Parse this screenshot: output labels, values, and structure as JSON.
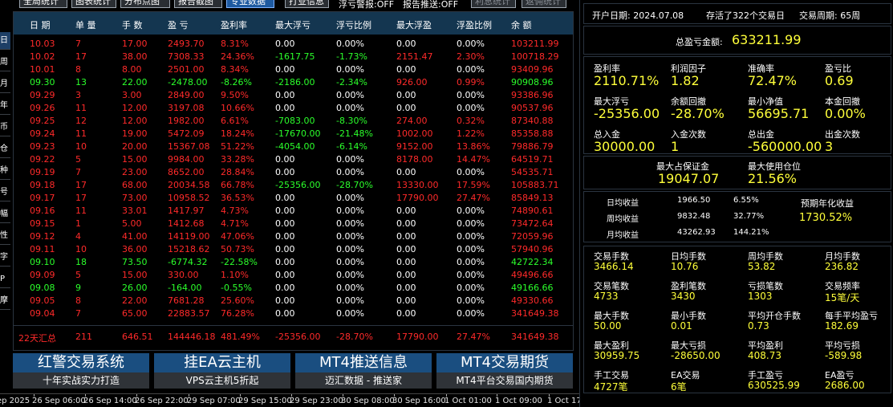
{
  "toolbar": {
    "buttons": [
      {
        "label": "全局统计"
      },
      {
        "label": "图表统计"
      },
      {
        "label": "分布点图"
      },
      {
        "label": "报告截图"
      },
      {
        "label": "专业数据"
      },
      {
        "label": "打业信息"
      },
      {
        "label": "利息统计"
      },
      {
        "label": "返佣统计"
      }
    ],
    "float_warn": "浮亏警报:OFF",
    "report_push": "报告推送:OFF"
  },
  "vtabs": [
    "日",
    "周",
    "月",
    "年",
    "币",
    "仓",
    "种",
    "号",
    "幅",
    "性",
    "字",
    "P",
    "摩"
  ],
  "table": {
    "headers": [
      "日 期",
      "单 量",
      "手 数",
      "盈 亏",
      "盈利率",
      "最大浮亏",
      "浮亏比例",
      "最大浮盈",
      "浮盈比例",
      "余 额"
    ],
    "rows": [
      [
        "10.03",
        "7",
        "17.00",
        "2493.70",
        "8.31%",
        "0.00",
        "0.00%",
        "0.00",
        "0.00%",
        "103211.99"
      ],
      [
        "10.02",
        "17",
        "38.00",
        "7308.33",
        "24.36%",
        "-1617.75",
        "-1.73%",
        "2151.47",
        "2.30%",
        "100718.29"
      ],
      [
        "10.01",
        "8",
        "8.00",
        "2501.00",
        "8.34%",
        "0.00",
        "0.00%",
        "0.00",
        "0.00%",
        "93409.96"
      ],
      [
        "09.30",
        "13",
        "22.00",
        "-2478.00",
        "-8.26%",
        "-2186.00",
        "-2.34%",
        "926.00",
        "0.99%",
        "90908.96"
      ],
      [
        "09.29",
        "3",
        "3.00",
        "2849.00",
        "9.50%",
        "0.00",
        "0.00%",
        "0.00",
        "0.00%",
        "93386.96"
      ],
      [
        "09.26",
        "11",
        "12.00",
        "3197.08",
        "10.66%",
        "0.00",
        "0.00%",
        "0.00",
        "0.00%",
        "90537.96"
      ],
      [
        "09.25",
        "12",
        "12.00",
        "1982.00",
        "6.61%",
        "-7083.00",
        "-8.30%",
        "274.00",
        "0.32%",
        "87340.88"
      ],
      [
        "09.24",
        "11",
        "19.00",
        "5472.09",
        "18.24%",
        "-17670.00",
        "-21.48%",
        "1002.00",
        "1.22%",
        "85358.88"
      ],
      [
        "09.23",
        "10",
        "20.00",
        "15367.08",
        "51.22%",
        "-4054.00",
        "-6.14%",
        "9152.00",
        "13.86%",
        "79886.79"
      ],
      [
        "09.22",
        "5",
        "15.00",
        "9984.00",
        "33.28%",
        "0.00",
        "0.00%",
        "8178.00",
        "14.47%",
        "64519.71"
      ],
      [
        "09.19",
        "7",
        "23.00",
        "8652.00",
        "28.84%",
        "0.00",
        "0.00%",
        "0.00",
        "0.00%",
        "54535.71"
      ],
      [
        "09.18",
        "17",
        "68.00",
        "20034.58",
        "66.78%",
        "-25356.00",
        "-28.70%",
        "13330.00",
        "17.59%",
        "105883.71"
      ],
      [
        "09.17",
        "17",
        "73.00",
        "10958.52",
        "36.53%",
        "0.00",
        "0.00%",
        "17790.00",
        "27.47%",
        "85849.13"
      ],
      [
        "09.16",
        "11",
        "33.01",
        "1417.97",
        "4.73%",
        "0.00",
        "0.00%",
        "0.00",
        "0.00%",
        "74890.61"
      ],
      [
        "09.15",
        "1",
        "5.00",
        "1412.68",
        "4.71%",
        "0.00",
        "0.00%",
        "0.00",
        "0.00%",
        "73472.64"
      ],
      [
        "09.12",
        "4",
        "41.00",
        "14119.00",
        "47.06%",
        "0.00",
        "0.00%",
        "0.00",
        "0.00%",
        "72059.96"
      ],
      [
        "09.11",
        "10",
        "36.00",
        "15218.62",
        "50.73%",
        "0.00",
        "0.00%",
        "0.00",
        "0.00%",
        "57940.96"
      ],
      [
        "09.10",
        "18",
        "73.50",
        "-6774.32",
        "-22.58%",
        "0.00",
        "0.00%",
        "0.00",
        "0.00%",
        "42722.34"
      ],
      [
        "09.09",
        "5",
        "15.00",
        "330.00",
        "1.10%",
        "0.00",
        "0.00%",
        "0.00",
        "0.00%",
        "49496.66"
      ],
      [
        "09.08",
        "9",
        "26.00",
        "-164.00",
        "-0.55%",
        "0.00",
        "0.00%",
        "0.00",
        "0.00%",
        "49166.66"
      ],
      [
        "09.05",
        "8",
        "22.00",
        "7681.28",
        "25.60%",
        "0.00",
        "0.00%",
        "0.00",
        "0.00%",
        "49330.66"
      ],
      [
        "09.04",
        "7",
        "65.00",
        "22883.57",
        "76.28%",
        "0.00",
        "0.00%",
        "0.00",
        "0.00%",
        "341649.38"
      ]
    ],
    "summary": [
      "22天汇总",
      "211",
      "646.51",
      "144446.18",
      "481.49%",
      "-25356.00",
      "-28.70%",
      "17790.00",
      "27.47%",
      "341649.38"
    ]
  },
  "ads": [
    {
      "title": "红警交易系统",
      "sub": "十年实战实力打造"
    },
    {
      "title": "挂EA云主机",
      "sub": "VPS云主机5折起"
    },
    {
      "title": "MT4推送信息",
      "sub": "迈汇数据 - 推送家"
    },
    {
      "title": "MT4交易期货",
      "sub": "MT4平台交易国内期货"
    }
  ],
  "timeline": [
    "ep 2025",
    "26 Sep 06:00",
    "26 Sep 14:00",
    "26 Sep 22:00",
    "29 Sep 07:00",
    "29 Sep 15:00",
    "29 Sep 23:00",
    "30 Sep 08:00",
    "30 Sep 16:00",
    "1 Oct 01:00",
    "1 Oct 09:00",
    "1 Oct 17:00",
    "2 Oct 02:00",
    "2 Oct 10:00",
    "2 Oct 18:00",
    "3 Oct 03:00"
  ],
  "panel": {
    "header": {
      "open_date": "开户日期: 2024.07.08",
      "alive": "存活了322个交易日",
      "cycle": "交易周期: 65周"
    },
    "total": {
      "label": "总盈亏金额:",
      "value": "633211.99"
    },
    "grid1": [
      [
        {
          "label": "盈利率",
          "value": "2110.71%"
        },
        {
          "label": "利润因子",
          "value": "1.82"
        },
        {
          "label": "准确率",
          "value": "72.47%"
        },
        {
          "label": "盈亏比",
          "value": "0.69"
        }
      ],
      [
        {
          "label": "最大浮亏",
          "value": "-25356.00"
        },
        {
          "label": "余额回撤",
          "value": "-28.70%"
        },
        {
          "label": "最小净值",
          "value": "56695.71"
        },
        {
          "label": "本金回撤",
          "value": "0.00%"
        }
      ],
      [
        {
          "label": "总入金",
          "value": "30000.00"
        },
        {
          "label": "入金次数",
          "value": "1"
        },
        {
          "label": "总出金",
          "value": "-560000.00"
        },
        {
          "label": "出金次数",
          "value": "3"
        }
      ]
    ],
    "margin": [
      {
        "label": "最大占保证金",
        "value": "19047.07"
      },
      {
        "label": "最大使用仓位",
        "value": "21.56%"
      }
    ],
    "avg": [
      {
        "label": "日均收益",
        "amount": "1966.50",
        "pct": "6.55%"
      },
      {
        "label": "周均收益",
        "amount": "9832.48",
        "pct": "32.77%"
      },
      {
        "label": "月均收益",
        "amount": "43262.93",
        "pct": "144.21%"
      }
    ],
    "annual": {
      "label": "预期年化收益",
      "value": "1730.52%"
    },
    "grid2": [
      [
        {
          "label": "交易手数",
          "value": "3466.14"
        },
        {
          "label": "日均手数",
          "value": "10.76"
        },
        {
          "label": "周均手数",
          "value": "53.82"
        },
        {
          "label": "月均手数",
          "value": "236.82"
        }
      ],
      [
        {
          "label": "交易笔数",
          "value": "4733"
        },
        {
          "label": "盈利笔数",
          "value": "3430"
        },
        {
          "label": "亏损笔数",
          "value": "1303"
        },
        {
          "label": "交易频率",
          "value": "15笔/天"
        }
      ],
      [
        {
          "label": "最大手数",
          "value": "50.00"
        },
        {
          "label": "最小手数",
          "value": "0.01"
        },
        {
          "label": "平均开仓手数",
          "value": "0.73"
        },
        {
          "label": "每手平均盈亏",
          "value": "182.69"
        }
      ],
      [
        {
          "label": "最大盈利",
          "value": "30959.75"
        },
        {
          "label": "最大亏损",
          "value": "-28650.00"
        },
        {
          "label": "平均盈利",
          "value": "408.73"
        },
        {
          "label": "平均亏损",
          "value": "-589.98"
        }
      ],
      [
        {
          "label": "手工交易",
          "value": "4727笔"
        },
        {
          "label": "EA交易",
          "value": "6笔"
        },
        {
          "label": "手工盈亏",
          "value": "630525.99"
        },
        {
          "label": "EA盈亏",
          "value": "2686.00"
        }
      ]
    ]
  },
  "colors": {
    "positive": "#ff2a2a",
    "negative": "#2bff2b",
    "header_bg": "#143650",
    "stat_value": "#ffff3a",
    "ad_bg": "#1a4e80"
  }
}
